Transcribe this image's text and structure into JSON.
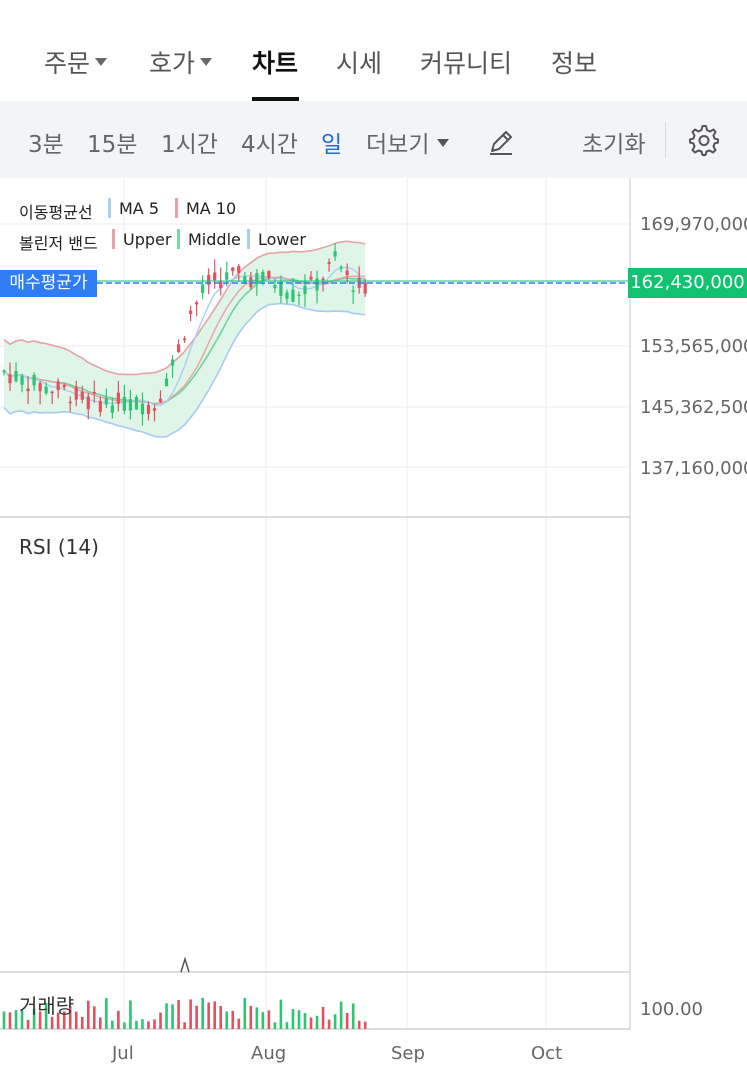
{
  "tabs": {
    "order": "주문",
    "orderbook": "호가",
    "chart": "차트",
    "quote": "시세",
    "community": "커뮤니티",
    "info": "정보"
  },
  "toolbar": {
    "intervals": [
      "3분",
      "15분",
      "1시간",
      "4시간",
      "일"
    ],
    "active_interval": "일",
    "more": "더보기",
    "reset": "초기화"
  },
  "legend": {
    "ma_title": "이동평균선",
    "ma5": "MA 5",
    "ma10": "MA 10",
    "bb_title": "볼린저 밴드",
    "upper": "Upper",
    "middle": "Middle",
    "lower": "Lower"
  },
  "price_axis": [
    "169,970,000",
    "153,565,000",
    "145,362,500",
    "137,160,000"
  ],
  "avg_buy_label": "매수평균가",
  "current_price": "162,430,000",
  "rsi_label": "RSI (14)",
  "volume_label": "거래량",
  "volume_axis": "100.00",
  "months": [
    "Jul",
    "Aug",
    "Sep",
    "Oct"
  ],
  "colors": {
    "up": "#2fc472",
    "down": "#e0525d",
    "ma5": "#a9cff2",
    "ma10": "#e9a0a6",
    "bb_fill": "#def5e8",
    "accent_blue": "#1f6bd6",
    "current_price_bg": "#12c270",
    "avg_label_bg": "#2e7df5"
  },
  "chart_data": {
    "type": "candlestick",
    "xlabel": "",
    "ylabel": "",
    "y_ticks": [
      169970000,
      153565000,
      145362500,
      137160000
    ],
    "current_price": 162430000,
    "x_month_ticks": [
      "Jul",
      "Aug",
      "Sep",
      "Oct"
    ],
    "series": [
      {
        "name": "MA 5"
      },
      {
        "name": "MA 10"
      },
      {
        "name": "Upper"
      },
      {
        "name": "Middle"
      },
      {
        "name": "Lower"
      }
    ]
  }
}
